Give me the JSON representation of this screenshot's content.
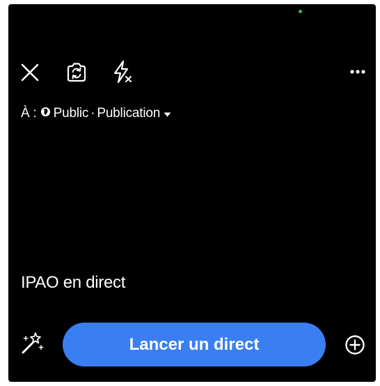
{
  "icons": {
    "close": "close-icon",
    "flip_camera": "camera-flip-icon",
    "flash": "flash-off-icon",
    "more": "more-options-icon",
    "globe": "globe-icon",
    "caret": "caret-down-icon",
    "effects": "magic-wand-icon",
    "add": "add-circle-icon"
  },
  "audience": {
    "prefix": "À :",
    "privacy": "Public",
    "separator": "·",
    "destination": "Publication"
  },
  "live_title": "IPAO en direct",
  "go_live_button": "Lancer un direct",
  "colors": {
    "background": "#000000",
    "accent": "#3a7ff1",
    "text": "#ffffff",
    "status_dot": "#2fc244"
  }
}
